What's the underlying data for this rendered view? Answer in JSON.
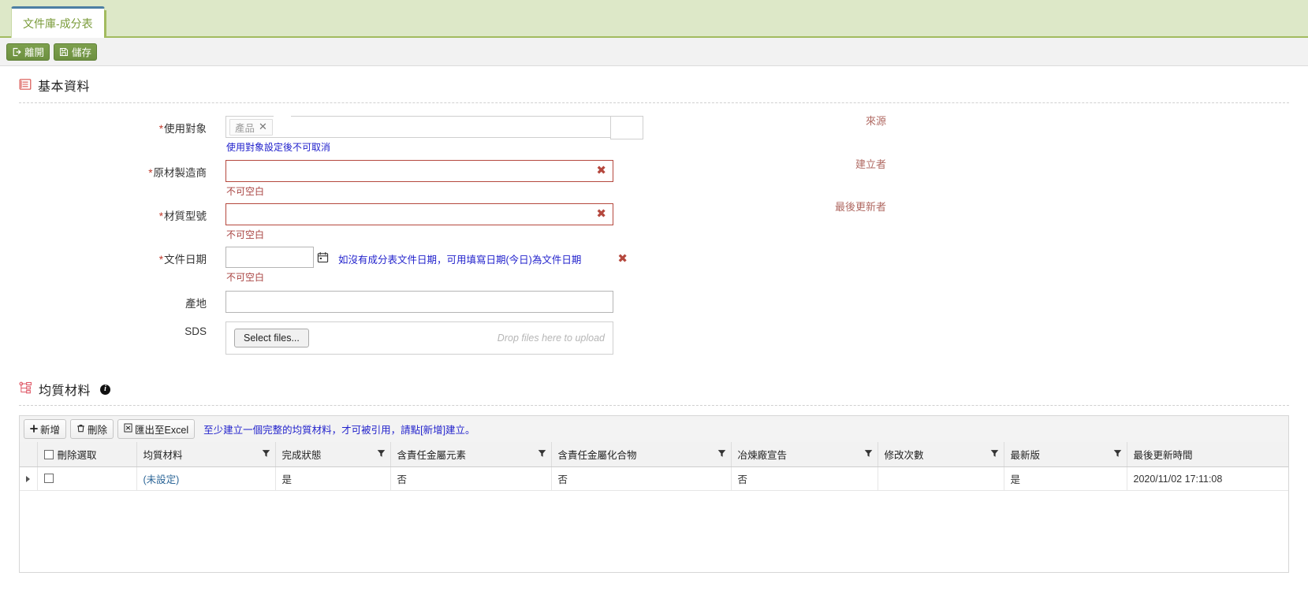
{
  "tab": {
    "label": "文件庫-成分表"
  },
  "actionbar": {
    "exit_label": "離開",
    "save_label": "儲存"
  },
  "basic_section": {
    "title": "基本資料",
    "icon": "list-icon",
    "fields": {
      "usage_target": {
        "label": "使用對象",
        "required": true,
        "chip": "產品",
        "chip_remove": "✕",
        "hint": "使用對象設定後不可取消"
      },
      "manufacturer": {
        "label": "原材製造商",
        "required": true,
        "value": "",
        "error": "不可空白",
        "side_label": "來源"
      },
      "material_model": {
        "label": "材質型號",
        "required": true,
        "value": "",
        "error": "不可空白",
        "side_label": "建立者"
      },
      "doc_date": {
        "label": "文件日期",
        "required": true,
        "value": "",
        "note": "如沒有成分表文件日期，可用填寫日期(今日)為文件日期",
        "error": "不可空白",
        "side_label": "最後更新者"
      },
      "origin": {
        "label": "產地",
        "required": false,
        "value": ""
      },
      "sds": {
        "label": "SDS",
        "required": false,
        "select_files_label": "Select files...",
        "drop_hint": "Drop files here to upload"
      }
    }
  },
  "homogeneous_section": {
    "title": "均質材料",
    "icon": "sitemap-icon",
    "info_icon": "info-icon",
    "toolbar": {
      "add_label": "新增",
      "delete_label": "刪除",
      "export_label": "匯出至Excel",
      "note": "至少建立一個完整的均質材料，才可被引用，請點[新增]建立。"
    },
    "grid": {
      "columns": [
        {
          "key": "expand",
          "label": ""
        },
        {
          "key": "select",
          "label": "刪除選取"
        },
        {
          "key": "material",
          "label": "均質材料"
        },
        {
          "key": "done",
          "label": "完成狀態"
        },
        {
          "key": "element",
          "label": "含責任金屬元素"
        },
        {
          "key": "compound",
          "label": "含責任金屬化合物"
        },
        {
          "key": "smelter",
          "label": "冶煉廠宣告"
        },
        {
          "key": "revisions",
          "label": "修改次數"
        },
        {
          "key": "latest",
          "label": "最新版"
        },
        {
          "key": "updated",
          "label": "最後更新時間"
        }
      ],
      "rows": [
        {
          "material": "(未設定)",
          "done": "是",
          "element": "否",
          "compound": "否",
          "smelter": "否",
          "revisions": "",
          "latest": "是",
          "updated": "2020/11/02 17:11:08"
        }
      ]
    }
  },
  "colors": {
    "tab_bar": "#dde8c8",
    "tab_text": "#7a9b3a",
    "button_green": "#7da04e",
    "error_red": "#b5483e",
    "link_blue": "#2222cc",
    "side_label": "#b06a63"
  }
}
